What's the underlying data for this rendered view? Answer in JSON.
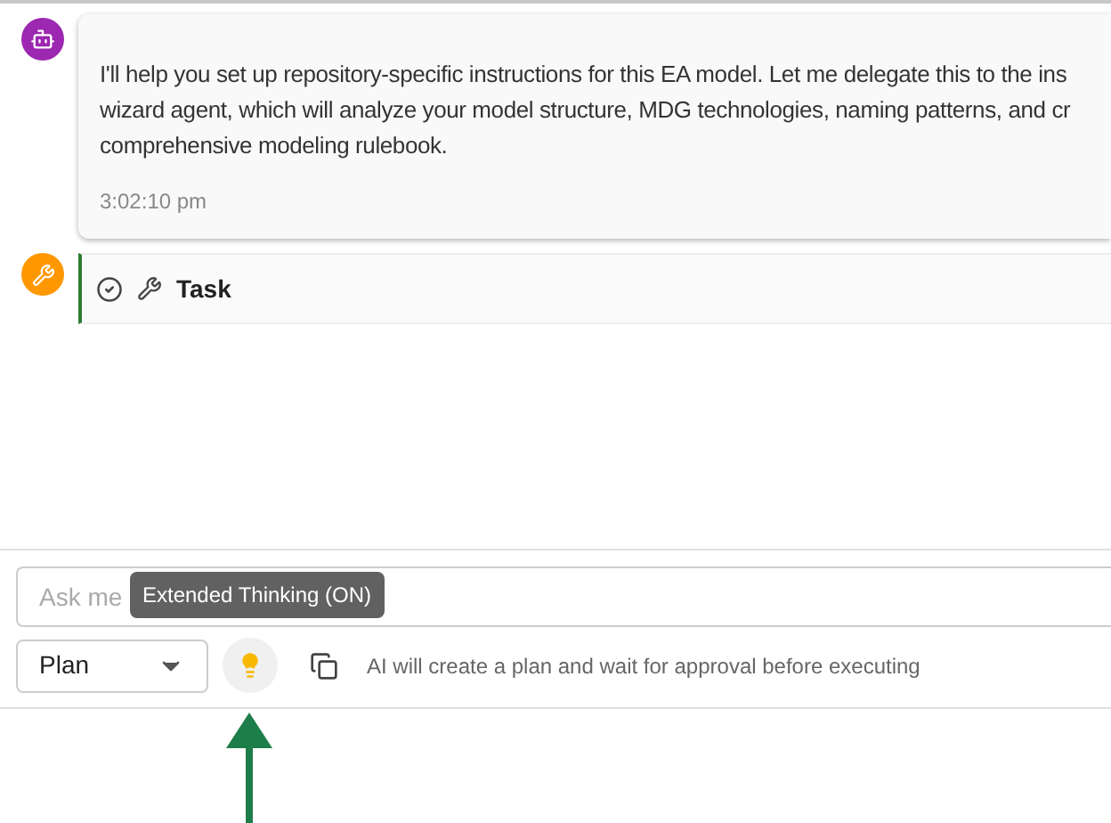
{
  "messages": [
    {
      "kind": "assistant",
      "lines": [
        "I'll help you set up repository-specific instructions for this EA model. Let me delegate this to the ins",
        "wizard agent, which will analyze your model structure, MDG technologies, naming patterns, and cr",
        "comprehensive modeling rulebook."
      ],
      "time": "3:02:10 pm"
    },
    {
      "kind": "tool",
      "done": true,
      "title": "Task"
    }
  ],
  "composer": {
    "placeholder": "Ask me",
    "tooltip": "Extended Thinking (ON)",
    "mode": "Plan",
    "thinking_on": true,
    "hint": "AI will create a plan and wait for approval before executing"
  }
}
